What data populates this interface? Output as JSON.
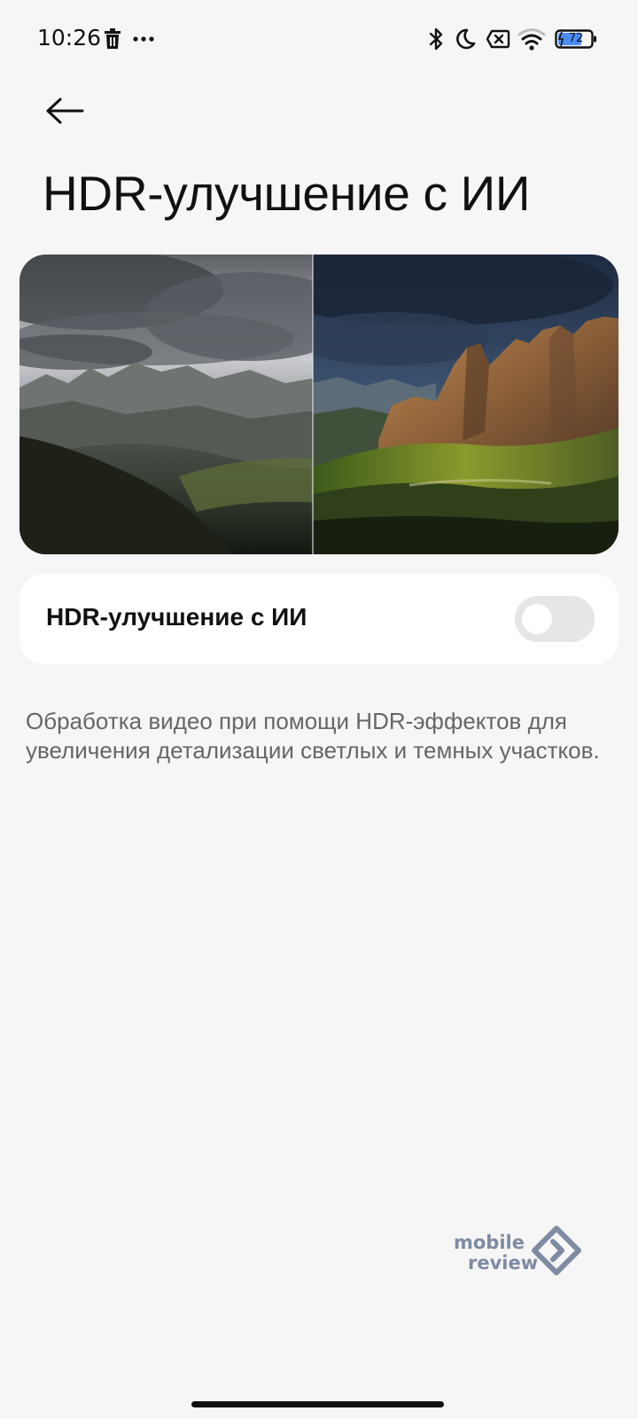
{
  "status_bar": {
    "time": "10:26",
    "battery_level": "72",
    "icons": [
      "trash-icon",
      "more-dots-icon",
      "bluetooth-icon",
      "moon-icon",
      "sim-x-icon",
      "wifi-icon",
      "battery-icon"
    ]
  },
  "header": {
    "back_icon": "arrow-left-icon",
    "title": "HDR-улучшение с ИИ"
  },
  "preview": {
    "description_hidden": ""
  },
  "setting": {
    "label": "HDR-улучшение с ИИ",
    "toggle_on": false
  },
  "description": "Обработка видео при помощи HDR-эффектов для увеличения детализации светлых и темных участков.",
  "watermark": {
    "line1": "mobile",
    "line2": "review"
  },
  "colors": {
    "background": "#f6f6f6",
    "card": "#ffffff",
    "toggle_off": "#e6e6e6",
    "description_text": "#666666",
    "watermark": "#7d8ba3"
  }
}
